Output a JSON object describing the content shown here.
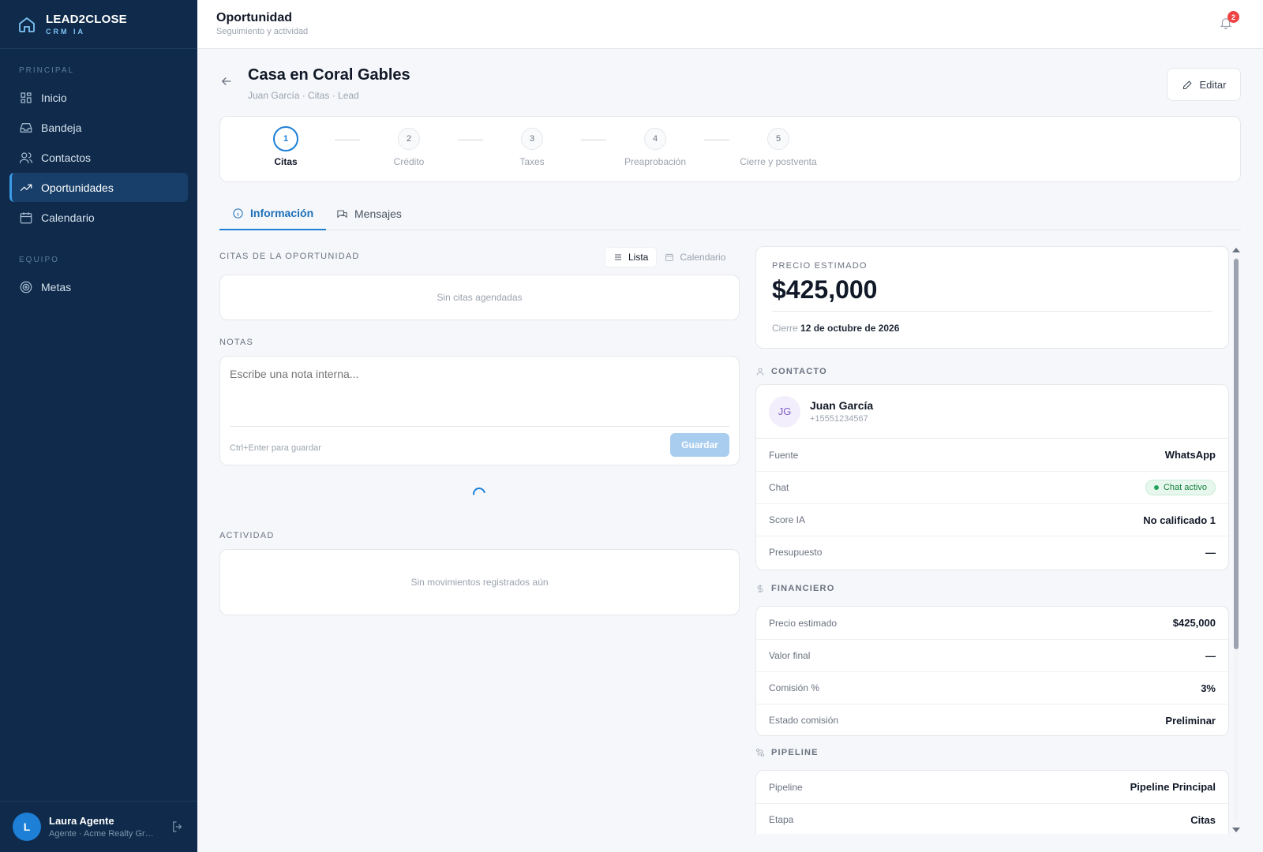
{
  "brand": {
    "name_a": "LEAD2",
    "name_b": "CLOSE",
    "sub": "CRM IA"
  },
  "sidebar": {
    "section_main": "PRINCIPAL",
    "items": [
      {
        "label": "Inicio",
        "icon": "grid-icon"
      },
      {
        "label": "Bandeja",
        "icon": "inbox-icon"
      },
      {
        "label": "Contactos",
        "icon": "users-icon"
      },
      {
        "label": "Oportunidades",
        "icon": "trending-icon",
        "active": true
      },
      {
        "label": "Calendario",
        "icon": "calendar-icon"
      }
    ],
    "section_team": "EQUIPO",
    "team_items": [
      {
        "label": "Metas",
        "icon": "target-icon"
      }
    ],
    "user": {
      "initial": "L",
      "name": "Laura Agente",
      "role": "Agente · Acme Realty Group"
    }
  },
  "topbar": {
    "title": "Oportunidad",
    "subtitle": "Seguimiento y actividad",
    "notifications": "2"
  },
  "header": {
    "title": "Casa en Coral Gables",
    "crumbs": "Juan García · Citas · Lead",
    "edit_label": "Editar"
  },
  "stepper": {
    "steps": [
      {
        "num": "1",
        "label": "Citas",
        "active": true
      },
      {
        "num": "2",
        "label": "Crédito"
      },
      {
        "num": "3",
        "label": "Taxes"
      },
      {
        "num": "4",
        "label": "Preaprobación"
      },
      {
        "num": "5",
        "label": "Cierre y postventa"
      }
    ]
  },
  "tabs": [
    {
      "label": "Información",
      "active": true
    },
    {
      "label": "Mensajes"
    }
  ],
  "citas": {
    "label": "CITAS DE LA OPORTUNIDAD",
    "view_list": "Lista",
    "view_calendar": "Calendario",
    "empty": "Sin citas agendadas"
  },
  "notas": {
    "label": "NOTAS",
    "placeholder": "Escribe una nota interna...",
    "hint": "Ctrl+Enter para guardar",
    "save": "Guardar"
  },
  "actividad": {
    "label": "ACTIVIDAD",
    "empty": "Sin movimientos registrados aún"
  },
  "precio": {
    "label": "PRECIO ESTIMADO",
    "value": "$425,000",
    "close_prefix": "Cierre",
    "close_date": "12 de octubre de 2026"
  },
  "contacto": {
    "label": "CONTACTO",
    "initials": "JG",
    "name": "Juan García",
    "phone": "+15551234567",
    "fields": {
      "fuente_k": "Fuente",
      "fuente_v": "WhatsApp",
      "chat_k": "Chat",
      "chat_v": "Chat activo",
      "score_k": "Score IA",
      "score_v": "No calificado 1",
      "presupuesto_k": "Presupuesto",
      "presupuesto_v": "—"
    }
  },
  "financiero": {
    "label": "FINANCIERO",
    "rows": [
      {
        "k": "Precio estimado",
        "v": "$425,000"
      },
      {
        "k": "Valor final",
        "v": "—"
      },
      {
        "k": "Comisión %",
        "v": "3%"
      },
      {
        "k": "Estado comisión",
        "v": "Preliminar"
      }
    ]
  },
  "pipeline": {
    "label": "PIPELINE",
    "rows": [
      {
        "k": "Pipeline",
        "v": "Pipeline Principal"
      },
      {
        "k": "Etapa",
        "v": "Citas"
      }
    ]
  }
}
